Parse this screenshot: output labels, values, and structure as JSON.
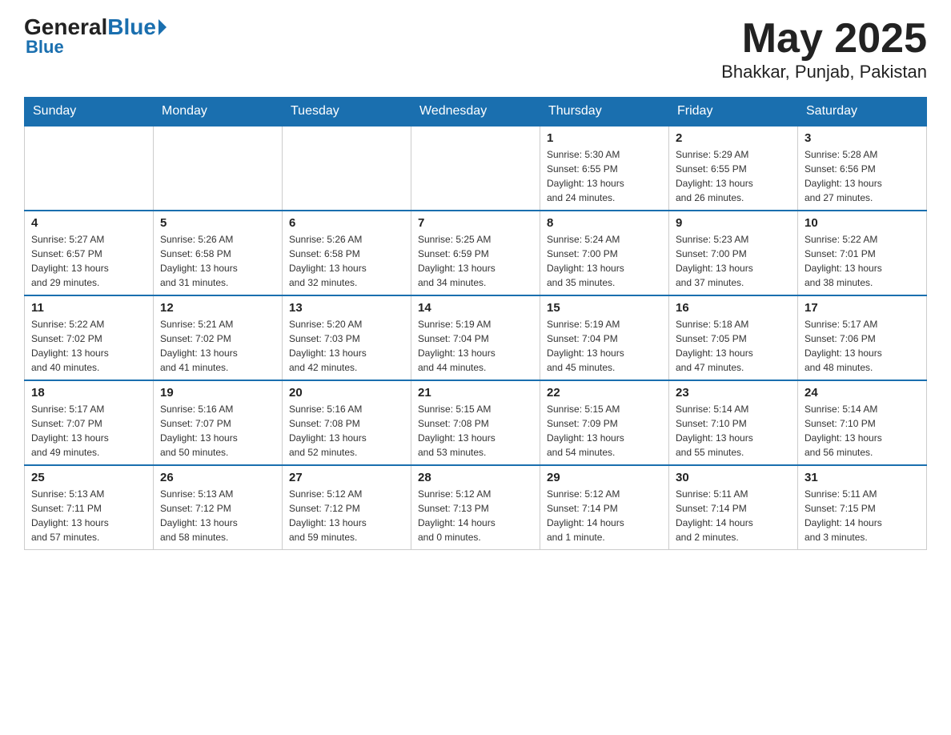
{
  "header": {
    "logo_general": "General",
    "logo_blue": "Blue",
    "month_title": "May 2025",
    "location": "Bhakkar, Punjab, Pakistan"
  },
  "days_of_week": [
    "Sunday",
    "Monday",
    "Tuesday",
    "Wednesday",
    "Thursday",
    "Friday",
    "Saturday"
  ],
  "weeks": [
    [
      {
        "day": "",
        "info": ""
      },
      {
        "day": "",
        "info": ""
      },
      {
        "day": "",
        "info": ""
      },
      {
        "day": "",
        "info": ""
      },
      {
        "day": "1",
        "info": "Sunrise: 5:30 AM\nSunset: 6:55 PM\nDaylight: 13 hours\nand 24 minutes."
      },
      {
        "day": "2",
        "info": "Sunrise: 5:29 AM\nSunset: 6:55 PM\nDaylight: 13 hours\nand 26 minutes."
      },
      {
        "day": "3",
        "info": "Sunrise: 5:28 AM\nSunset: 6:56 PM\nDaylight: 13 hours\nand 27 minutes."
      }
    ],
    [
      {
        "day": "4",
        "info": "Sunrise: 5:27 AM\nSunset: 6:57 PM\nDaylight: 13 hours\nand 29 minutes."
      },
      {
        "day": "5",
        "info": "Sunrise: 5:26 AM\nSunset: 6:58 PM\nDaylight: 13 hours\nand 31 minutes."
      },
      {
        "day": "6",
        "info": "Sunrise: 5:26 AM\nSunset: 6:58 PM\nDaylight: 13 hours\nand 32 minutes."
      },
      {
        "day": "7",
        "info": "Sunrise: 5:25 AM\nSunset: 6:59 PM\nDaylight: 13 hours\nand 34 minutes."
      },
      {
        "day": "8",
        "info": "Sunrise: 5:24 AM\nSunset: 7:00 PM\nDaylight: 13 hours\nand 35 minutes."
      },
      {
        "day": "9",
        "info": "Sunrise: 5:23 AM\nSunset: 7:00 PM\nDaylight: 13 hours\nand 37 minutes."
      },
      {
        "day": "10",
        "info": "Sunrise: 5:22 AM\nSunset: 7:01 PM\nDaylight: 13 hours\nand 38 minutes."
      }
    ],
    [
      {
        "day": "11",
        "info": "Sunrise: 5:22 AM\nSunset: 7:02 PM\nDaylight: 13 hours\nand 40 minutes."
      },
      {
        "day": "12",
        "info": "Sunrise: 5:21 AM\nSunset: 7:02 PM\nDaylight: 13 hours\nand 41 minutes."
      },
      {
        "day": "13",
        "info": "Sunrise: 5:20 AM\nSunset: 7:03 PM\nDaylight: 13 hours\nand 42 minutes."
      },
      {
        "day": "14",
        "info": "Sunrise: 5:19 AM\nSunset: 7:04 PM\nDaylight: 13 hours\nand 44 minutes."
      },
      {
        "day": "15",
        "info": "Sunrise: 5:19 AM\nSunset: 7:04 PM\nDaylight: 13 hours\nand 45 minutes."
      },
      {
        "day": "16",
        "info": "Sunrise: 5:18 AM\nSunset: 7:05 PM\nDaylight: 13 hours\nand 47 minutes."
      },
      {
        "day": "17",
        "info": "Sunrise: 5:17 AM\nSunset: 7:06 PM\nDaylight: 13 hours\nand 48 minutes."
      }
    ],
    [
      {
        "day": "18",
        "info": "Sunrise: 5:17 AM\nSunset: 7:07 PM\nDaylight: 13 hours\nand 49 minutes."
      },
      {
        "day": "19",
        "info": "Sunrise: 5:16 AM\nSunset: 7:07 PM\nDaylight: 13 hours\nand 50 minutes."
      },
      {
        "day": "20",
        "info": "Sunrise: 5:16 AM\nSunset: 7:08 PM\nDaylight: 13 hours\nand 52 minutes."
      },
      {
        "day": "21",
        "info": "Sunrise: 5:15 AM\nSunset: 7:08 PM\nDaylight: 13 hours\nand 53 minutes."
      },
      {
        "day": "22",
        "info": "Sunrise: 5:15 AM\nSunset: 7:09 PM\nDaylight: 13 hours\nand 54 minutes."
      },
      {
        "day": "23",
        "info": "Sunrise: 5:14 AM\nSunset: 7:10 PM\nDaylight: 13 hours\nand 55 minutes."
      },
      {
        "day": "24",
        "info": "Sunrise: 5:14 AM\nSunset: 7:10 PM\nDaylight: 13 hours\nand 56 minutes."
      }
    ],
    [
      {
        "day": "25",
        "info": "Sunrise: 5:13 AM\nSunset: 7:11 PM\nDaylight: 13 hours\nand 57 minutes."
      },
      {
        "day": "26",
        "info": "Sunrise: 5:13 AM\nSunset: 7:12 PM\nDaylight: 13 hours\nand 58 minutes."
      },
      {
        "day": "27",
        "info": "Sunrise: 5:12 AM\nSunset: 7:12 PM\nDaylight: 13 hours\nand 59 minutes."
      },
      {
        "day": "28",
        "info": "Sunrise: 5:12 AM\nSunset: 7:13 PM\nDaylight: 14 hours\nand 0 minutes."
      },
      {
        "day": "29",
        "info": "Sunrise: 5:12 AM\nSunset: 7:14 PM\nDaylight: 14 hours\nand 1 minute."
      },
      {
        "day": "30",
        "info": "Sunrise: 5:11 AM\nSunset: 7:14 PM\nDaylight: 14 hours\nand 2 minutes."
      },
      {
        "day": "31",
        "info": "Sunrise: 5:11 AM\nSunset: 7:15 PM\nDaylight: 14 hours\nand 3 minutes."
      }
    ]
  ]
}
